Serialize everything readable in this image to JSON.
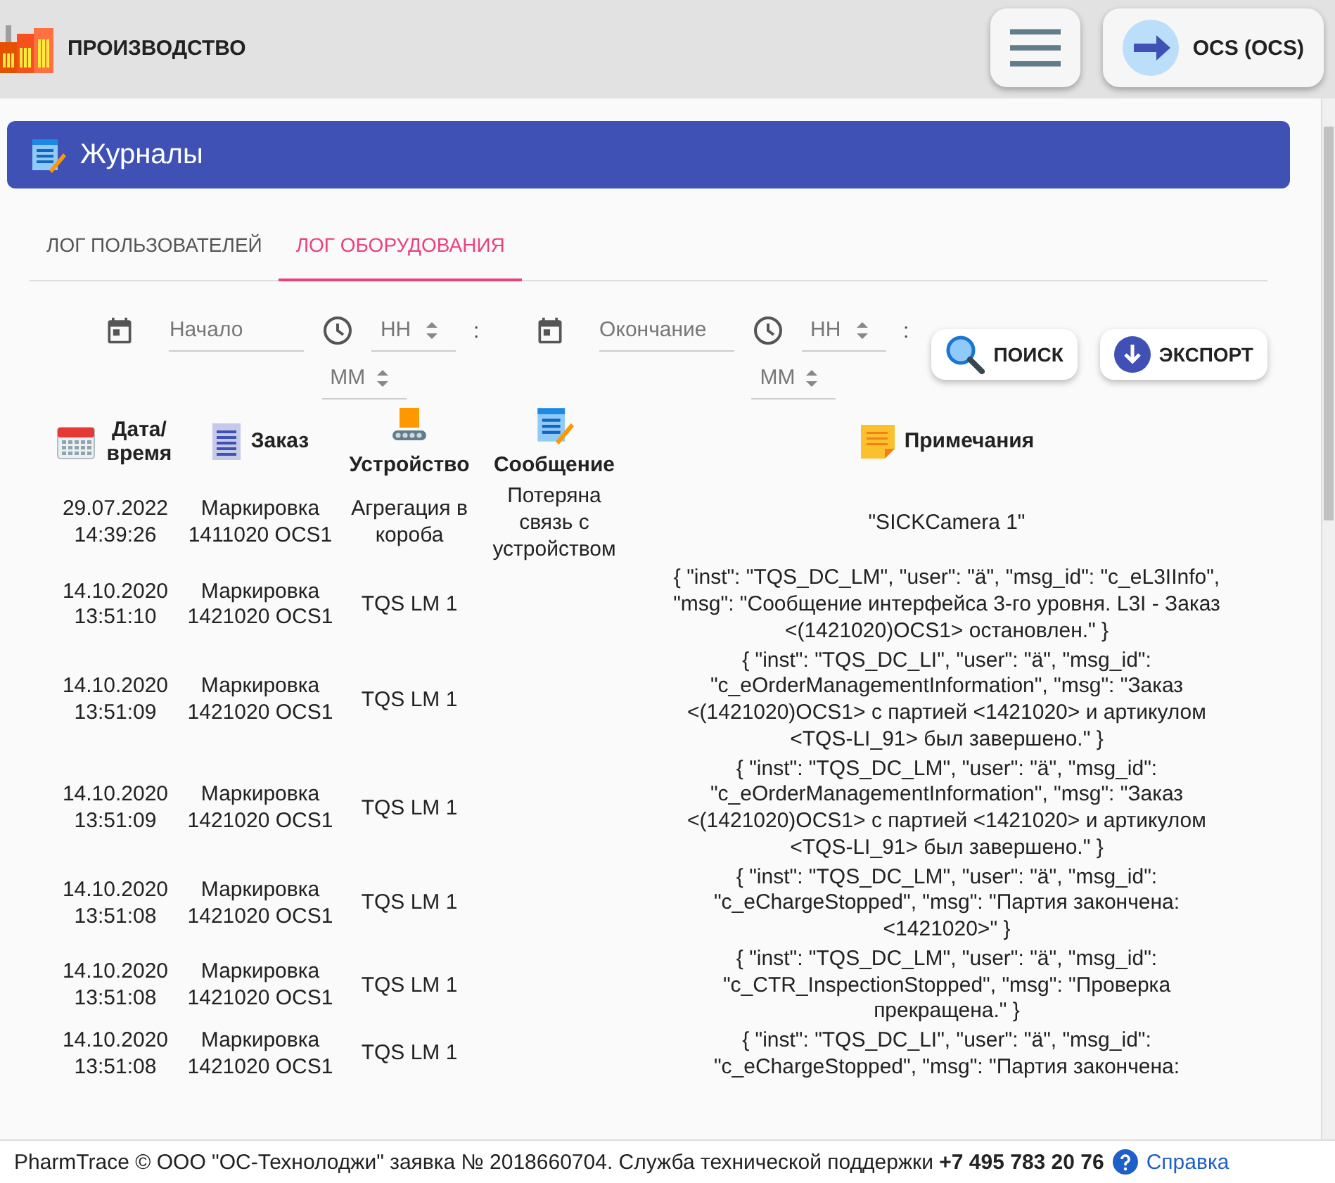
{
  "header": {
    "title": "ПРОИЗВОДСТВО",
    "user_button": {
      "label": "OCS (OCS)"
    }
  },
  "panel": {
    "title": "Журналы"
  },
  "tabs": [
    {
      "label": "ЛОГ ПОЛЬЗОВАТЕЛЕЙ",
      "selected": false
    },
    {
      "label": "ЛОГ ОБОРУДОВАНИЯ",
      "selected": true
    }
  ],
  "filters": [
    {
      "date_placeholder": "Начало",
      "hour_placeholder": "HH",
      "separator": ":",
      "minute_placeholder": "MM"
    },
    {
      "date_placeholder": "Окончание",
      "hour_placeholder": "HH",
      "separator": ":",
      "minute_placeholder": "MM"
    }
  ],
  "buttons": [
    {
      "label": "ПОИСК",
      "kind": "search"
    },
    {
      "label": "ЭКСПОРТ",
      "kind": "export"
    }
  ],
  "table": {
    "columns": [
      {
        "label": "Дата/ время",
        "kind": "datetime"
      },
      {
        "label": "Заказ",
        "kind": "order"
      },
      {
        "label": "Устройство",
        "kind": "device"
      },
      {
        "label": "Сообщение",
        "kind": "message"
      },
      {
        "label": "Примечания",
        "kind": "notes"
      }
    ],
    "rows": [
      {
        "cells": [
          "29.07.2022 14:39:26",
          "Маркировка 1411020 OCS1",
          "Агрегация в короба",
          "Потеряна связь с устройством",
          "\"SICKCamera 1\""
        ]
      },
      {
        "cells": [
          "14.10.2020 13:51:10",
          "Маркировка 1421020 OCS1",
          "TQS LM 1",
          "",
          "{ \"inst\": \"TQS_DC_LM\", \"user\": \"ä\", \"msg_id\": \"c_eL3IInfo\", \"msg\": \"Сообщение интерфейса 3-го уровня. L3I - Заказ <(1421020)OCS1> остановлен.\" }"
        ]
      },
      {
        "cells": [
          "14.10.2020 13:51:09",
          "Маркировка 1421020 OCS1",
          "TQS LM 1",
          "",
          "{ \"inst\": \"TQS_DC_LI\", \"user\": \"ä\", \"msg_id\": \"c_eOrderManagementInformation\", \"msg\": \"Заказ <(1421020)OCS1> с партией <1421020> и артикулом <TQS-LI_91> был завершено.\" }"
        ]
      },
      {
        "cells": [
          "14.10.2020 13:51:09",
          "Маркировка 1421020 OCS1",
          "TQS LM 1",
          "",
          "{ \"inst\": \"TQS_DC_LM\", \"user\": \"ä\", \"msg_id\": \"c_eOrderManagementInformation\", \"msg\": \"Заказ <(1421020)OCS1> с партией <1421020> и артикулом <TQS-LI_91> был завершено.\" }"
        ]
      },
      {
        "cells": [
          "14.10.2020 13:51:08",
          "Маркировка 1421020 OCS1",
          "TQS LM 1",
          "",
          "{ \"inst\": \"TQS_DC_LM\", \"user\": \"ä\", \"msg_id\": \"c_eChargeStopped\", \"msg\": \"Партия закончена: <1421020>\" }"
        ]
      },
      {
        "cells": [
          "14.10.2020 13:51:08",
          "Маркировка 1421020 OCS1",
          "TQS LM 1",
          "",
          "{ \"inst\": \"TQS_DC_LM\", \"user\": \"ä\", \"msg_id\": \"c_CTR_InspectionStopped\", \"msg\": \"Проверка прекращена.\" }"
        ]
      },
      {
        "cells": [
          "14.10.2020 13:51:08",
          "Маркировка 1421020 OCS1",
          "TQS LM 1",
          "",
          "{ \"inst\": \"TQS_DC_LI\", \"user\": \"ä\", \"msg_id\": \"c_eChargeStopped\", \"msg\": \"Партия закончена:"
        ]
      }
    ]
  },
  "footer": {
    "text": "PharmTrace © ООО \"ОС-Технолоджи\" заявка № 2018660704. Служба технической поддержки **+7 495 783 20 76**",
    "help_link": "Справка"
  }
}
